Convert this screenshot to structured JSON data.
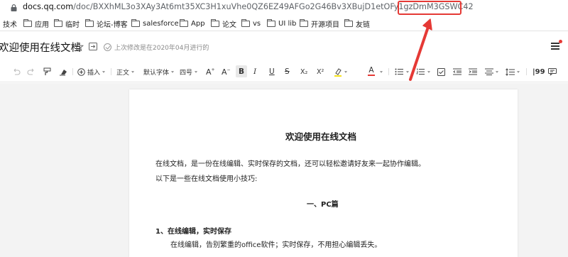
{
  "address_bar": {
    "host": "docs.qq.com",
    "path": "/doc/BXXhML3o3XAy3At6mt35XC3H1xuVhe0QZ6EZ49AFGo2G46Bv3XBujD1etOFy1gzDmM3GSWC42"
  },
  "bookmarks": [
    {
      "label": "技术"
    },
    {
      "label": "应用"
    },
    {
      "label": "临时"
    },
    {
      "label": "论坛-博客"
    },
    {
      "label": "salesforce"
    },
    {
      "label": "App"
    },
    {
      "label": "论文"
    },
    {
      "label": "vs"
    },
    {
      "label": "UI lib"
    },
    {
      "label": "开源项目"
    },
    {
      "label": "友链"
    }
  ],
  "doc": {
    "title": "欢迎使用在线文档",
    "saved_status": "上次修改是在2020年04月进行的"
  },
  "toolbar": {
    "insert": "插入",
    "style": "正文",
    "font": "默认字体",
    "size": "四号",
    "bold": "B",
    "italic": "I",
    "underline": "U",
    "strike": "S",
    "subscript": "X₂",
    "superscript": "X²",
    "font_color": "A",
    "quote": "|99"
  },
  "content": {
    "heading": "欢迎使用在线文档",
    "line1": "在线文档，是一份在线编辑、实时保存的文档，还可以轻松邀请好友来一起协作编辑。",
    "line2": "以下是一些在线文档使用小技巧:",
    "section": "一、PC篇",
    "subsection": "1、在线编辑，实时保存",
    "line3": "在线编辑，告别繁重的office软件；实时保存，不用担心编辑丢失。"
  },
  "colors": {
    "annotation": "#e53935",
    "highlight_swatch": "#f6e21b",
    "font_color_swatch": "#e53935"
  }
}
